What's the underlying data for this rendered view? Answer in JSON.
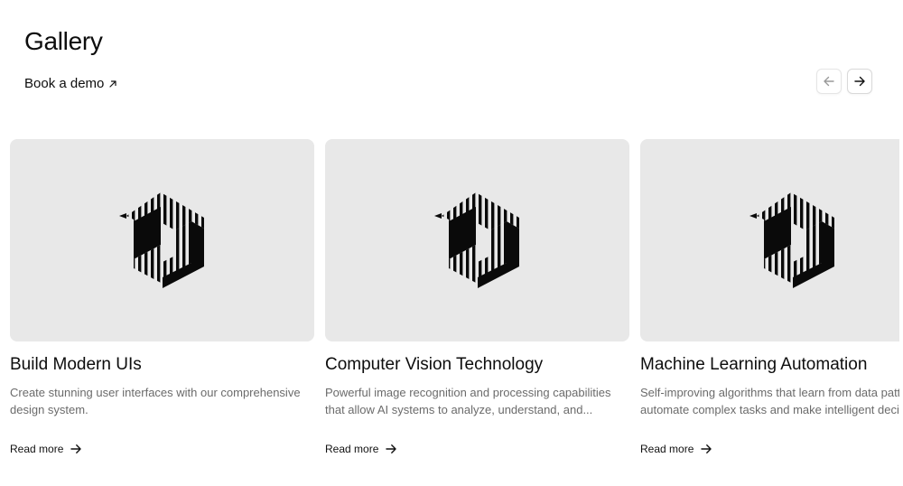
{
  "header": {
    "title": "Gallery",
    "demo_link_label": "Book a demo"
  },
  "navigation": {
    "prev_icon": "arrow-left-icon",
    "next_icon": "arrow-right-icon"
  },
  "cards": [
    {
      "title": "Build Modern UIs",
      "description_lines": [
        "Create stunning user interfaces with our comprehensive",
        "design system."
      ],
      "link_label": "Read more",
      "image_icon": "striped-cube-logo-icon"
    },
    {
      "title": "Computer Vision Technology",
      "description_lines": [
        "Powerful image recognition and processing capabilities",
        "that allow AI systems to analyze, understand, and..."
      ],
      "link_label": "Read more",
      "image_icon": "striped-cube-logo-icon"
    },
    {
      "title": "Machine Learning Automation",
      "description_lines": [
        "Self-improving algorithms that learn from data patterns to",
        "automate complex tasks and make intelligent decisions."
      ],
      "link_label": "Read more",
      "image_icon": "striped-cube-logo-icon"
    }
  ],
  "colors": {
    "background": "#ffffff",
    "card_media": "#e8e8e8",
    "text_primary": "#0d0d0d",
    "text_muted": "#6b6b6b"
  }
}
